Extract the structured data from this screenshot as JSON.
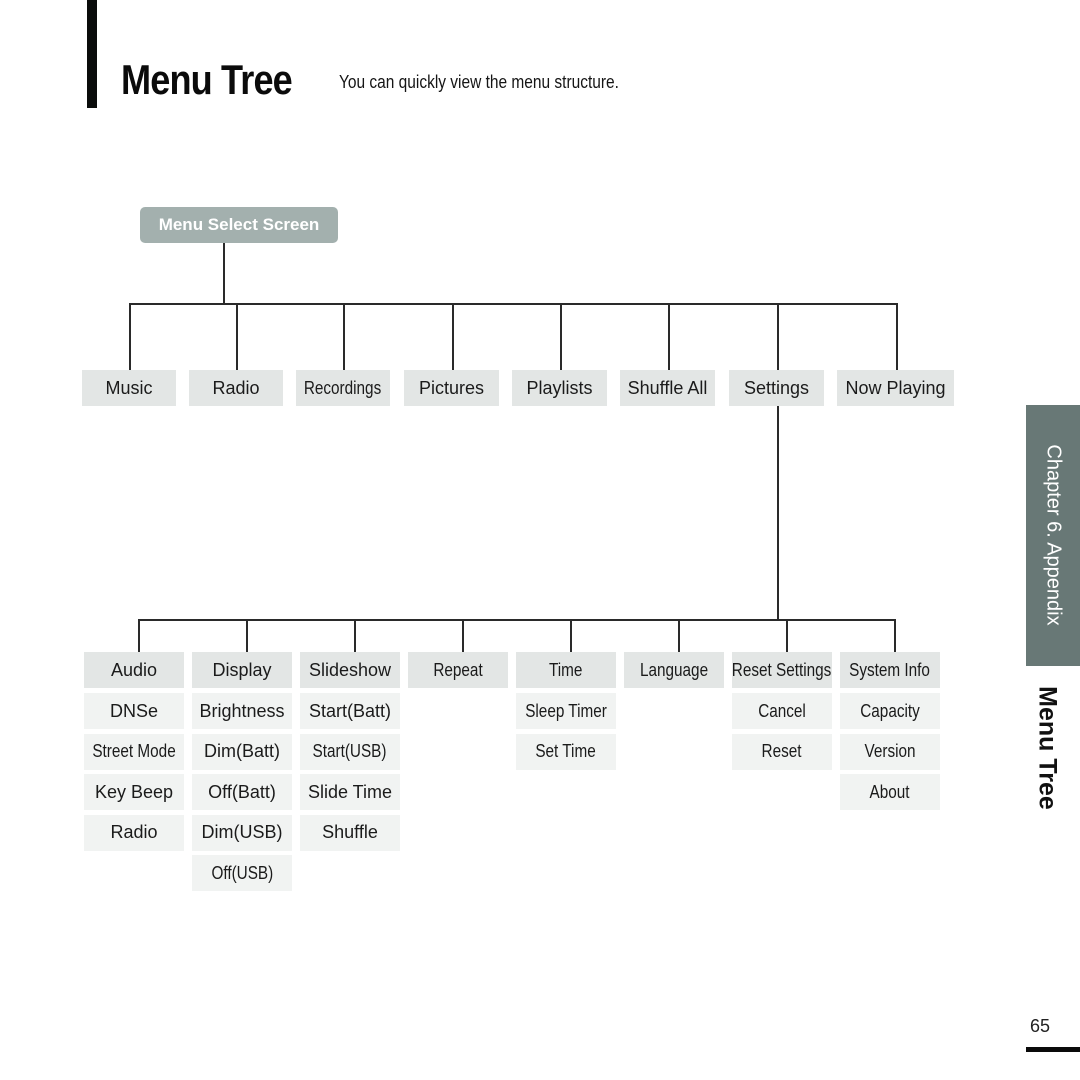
{
  "header": {
    "title": "Menu Tree",
    "subtitle": "You can quickly view the menu structure."
  },
  "tree": {
    "root": "Menu Select Screen",
    "top_level": [
      "Music",
      "Radio",
      "Recordings",
      "Pictures",
      "Playlists",
      "Shuffle All",
      "Settings",
      "Now Playing"
    ],
    "expanded_item": "Settings",
    "settings_children": [
      {
        "label": "Audio",
        "items": [
          "DNSe",
          "Street Mode",
          "Key Beep",
          "Radio"
        ]
      },
      {
        "label": "Display",
        "items": [
          "Brightness",
          "Dim(Batt)",
          "Off(Batt)",
          "Dim(USB)",
          "Off(USB)"
        ]
      },
      {
        "label": "Slideshow",
        "items": [
          "Start(Batt)",
          "Start(USB)",
          "Slide Time",
          "Shuffle"
        ]
      },
      {
        "label": "Repeat",
        "items": []
      },
      {
        "label": "Time",
        "items": [
          "Sleep Timer",
          "Set Time"
        ]
      },
      {
        "label": "Language",
        "items": []
      },
      {
        "label": "Reset Settings",
        "items": [
          "Cancel",
          "Reset"
        ]
      },
      {
        "label": "System Info",
        "items": [
          "Capacity",
          "Version",
          "About"
        ]
      }
    ]
  },
  "sidebar": {
    "chapter": "Chapter 6. Appendix",
    "section": "Menu Tree"
  },
  "footer": {
    "page_number": "65"
  },
  "colors": {
    "root_box": "#a3b0ae",
    "header_cell": "#e3e6e5",
    "sub_cell": "#f1f3f2",
    "chapter_tab": "#687876",
    "connector": "#2a2a2a"
  }
}
